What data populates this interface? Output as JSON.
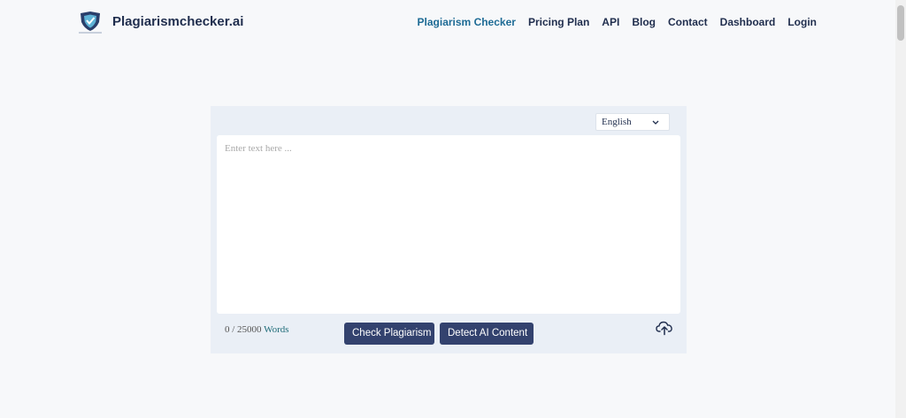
{
  "brand": {
    "name": "Plagiarismchecker.ai",
    "logo_icon": "shield-check-icon"
  },
  "nav": {
    "items": [
      {
        "label": "Plagiarism Checker",
        "active": true
      },
      {
        "label": "Pricing Plan"
      },
      {
        "label": "API"
      },
      {
        "label": "Blog"
      },
      {
        "label": "Contact"
      },
      {
        "label": "Dashboard"
      },
      {
        "label": "Login"
      }
    ]
  },
  "checker": {
    "language": "English",
    "text_placeholder": "Enter text here ...",
    "text_value": "",
    "word_count_value": "0 / 25000",
    "word_count_unit": "Words",
    "check_button": "Check Plagiarism",
    "detect_button": "Detect AI Content",
    "upload_icon": "cloud-upload-icon"
  },
  "colors": {
    "primary": "#33426e",
    "accent": "#1e6b95",
    "card_bg": "#eaeff6"
  }
}
